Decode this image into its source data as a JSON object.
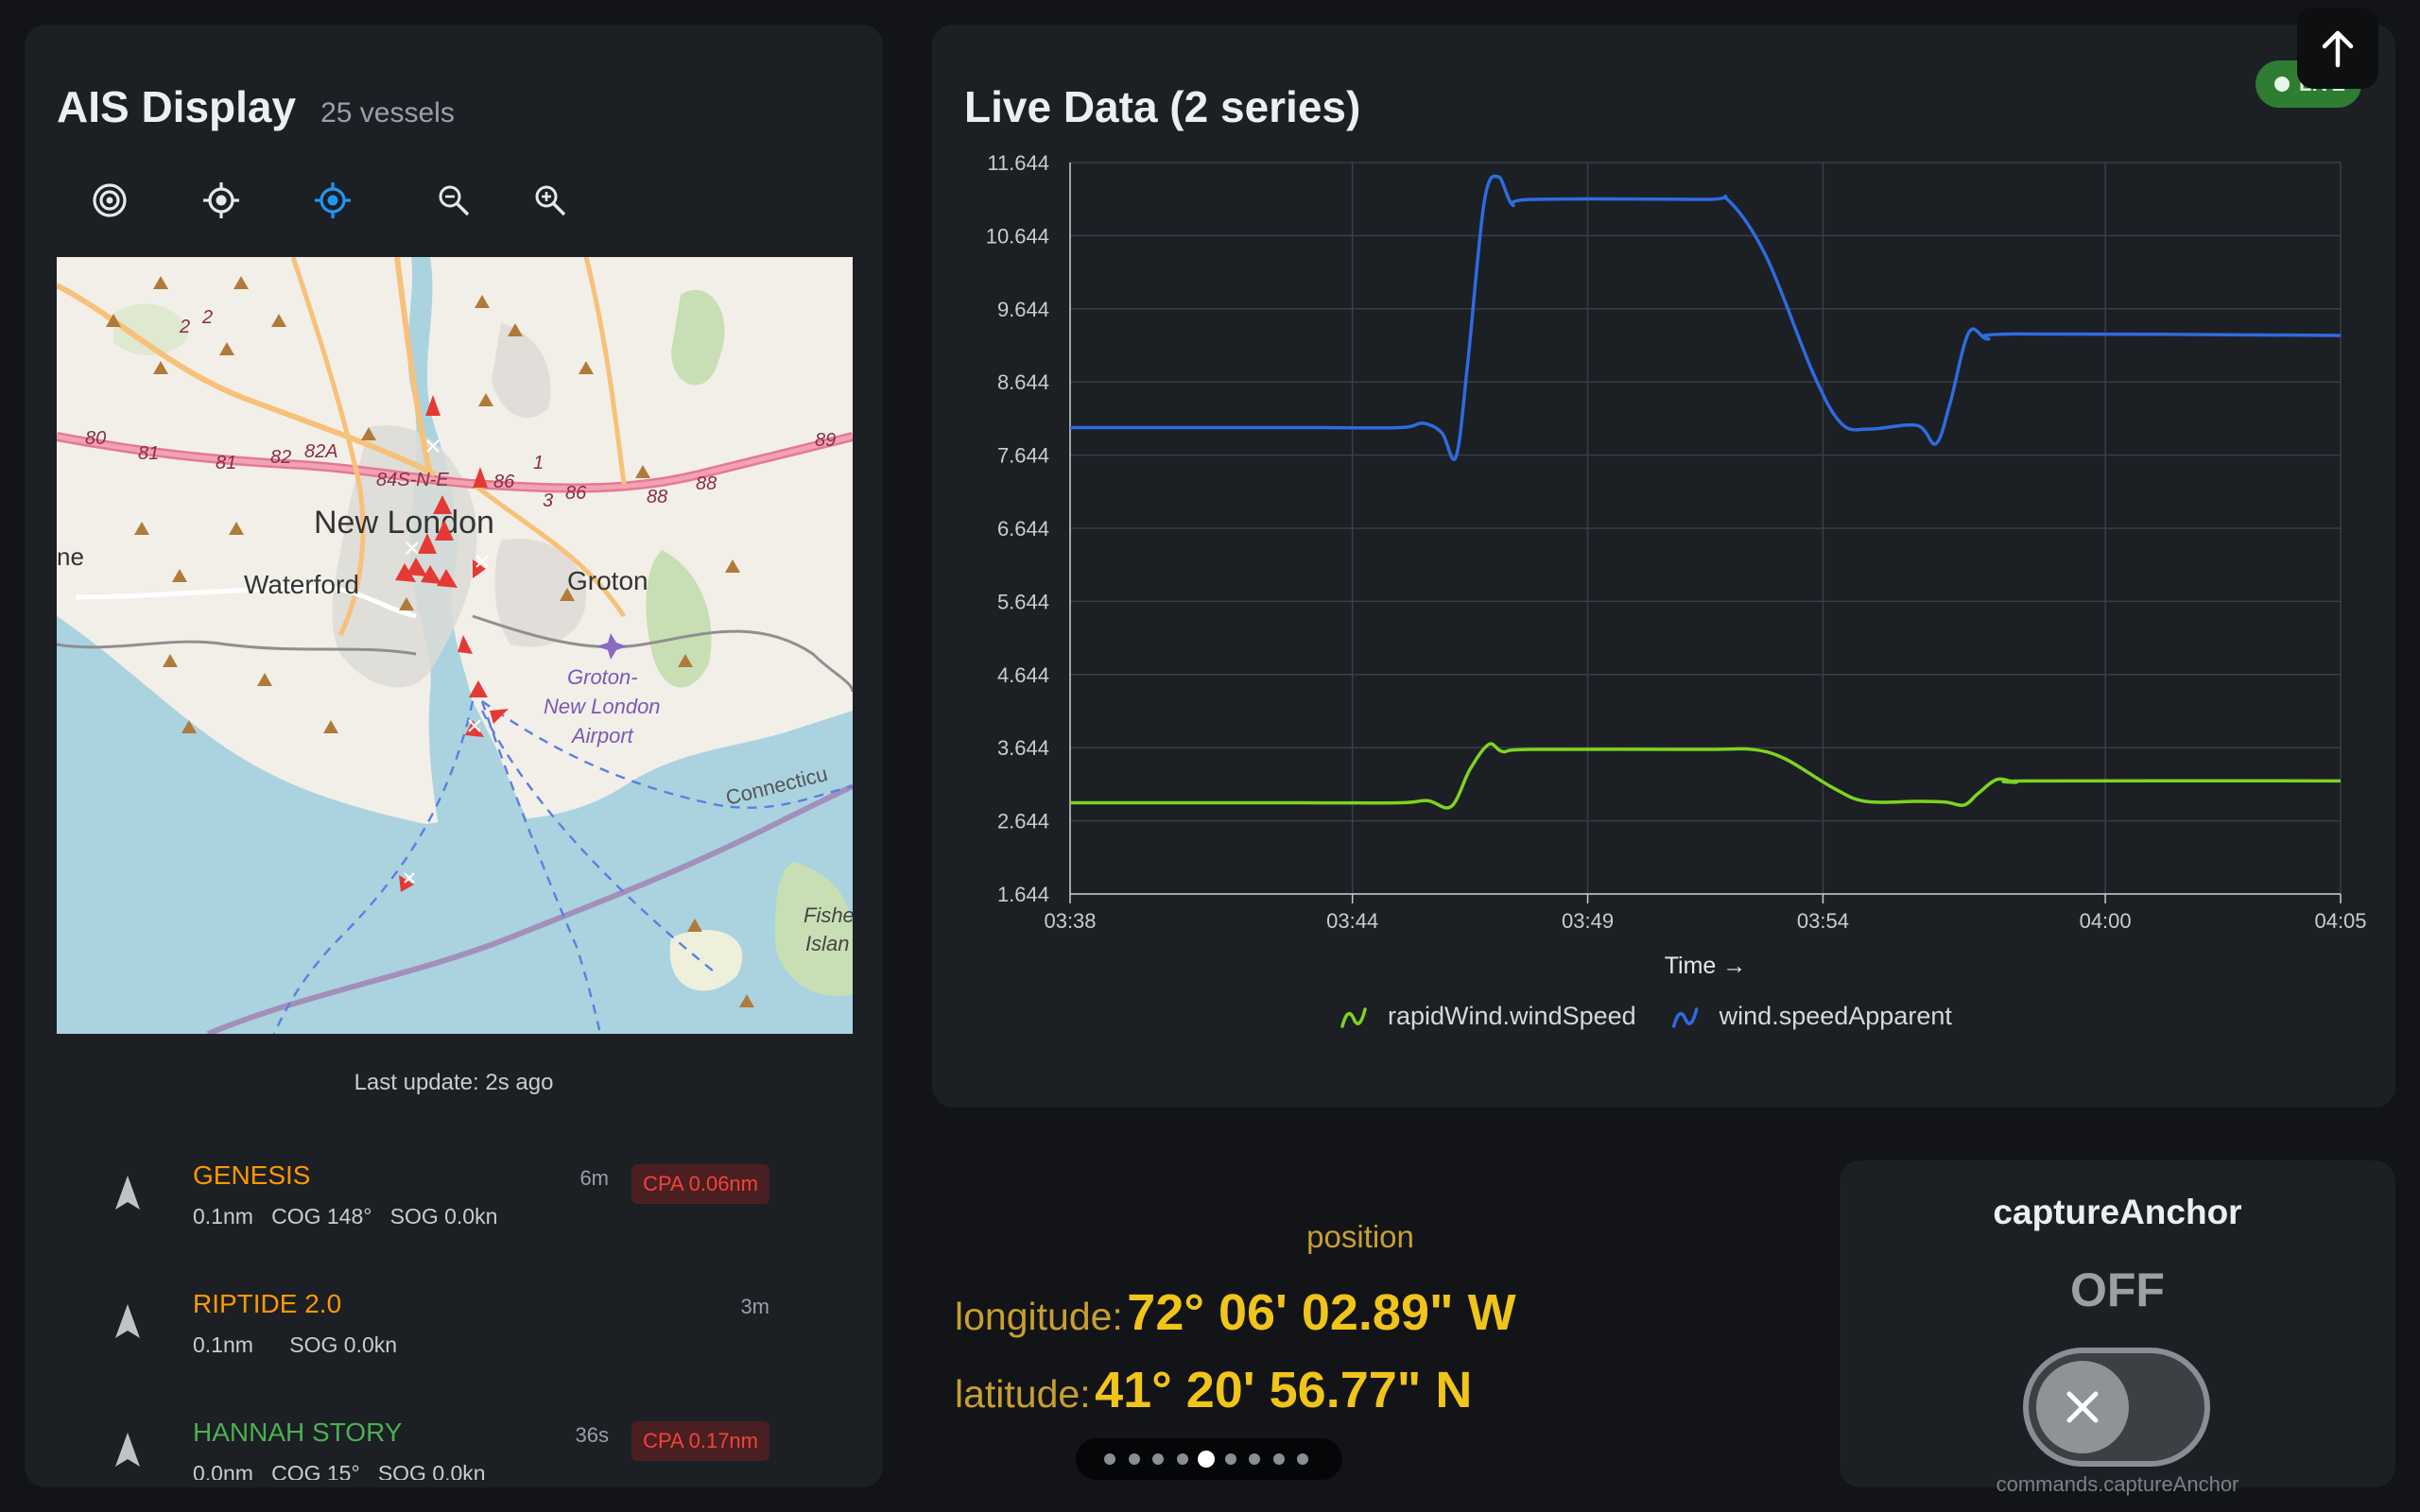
{
  "ais": {
    "title": "AIS Display",
    "vessel_count": "25 vessels",
    "toolbar": [
      "radar-icon",
      "center-icon",
      "follow-icon",
      "zoom-out-icon",
      "zoom-in-icon"
    ],
    "map": {
      "labels": [
        "New London",
        "Waterford",
        "Groton",
        "Groton-",
        "New London",
        "Airport",
        "Connecticu",
        "Fishe",
        "Islan",
        "ne",
        "80",
        "81",
        "81",
        "82",
        "82A",
        "84S-N-E",
        "86",
        "86",
        "88",
        "88",
        "89",
        "1",
        "3",
        "2",
        "2"
      ]
    },
    "last_update": "Last update: 2s ago",
    "vessels": [
      {
        "name": "GENESIS",
        "age": "6m",
        "detail": "0.1nm   COG 148°   SOG 0.0kn",
        "cpa": "CPA 0.06nm",
        "color": "#ff9800"
      },
      {
        "name": "RIPTIDE 2.0",
        "age": "3m",
        "detail": "0.1nm      SOG 0.0kn",
        "cpa": "",
        "color": "#ff9800"
      },
      {
        "name": "HANNAH STORY",
        "age": "36s",
        "detail": "0.0nm   COG 15°   SOG 0.0kn",
        "cpa": "CPA 0.17nm",
        "color": "#4caf50"
      }
    ]
  },
  "live": {
    "title": "Live Data (2 series)",
    "badge": "LIVE"
  },
  "chart_data": {
    "type": "line",
    "title": "",
    "xlabel": "Time →",
    "ylabel": "",
    "ylim": [
      1.644,
      11.644
    ],
    "xlim": [
      "03:38",
      "04:05"
    ],
    "x_ticks": [
      "03:38",
      "03:44",
      "03:49",
      "03:54",
      "04:00",
      "04:05"
    ],
    "y_ticks": [
      "1.644",
      "2.644",
      "3.644",
      "4.644",
      "5.644",
      "6.644",
      "7.644",
      "8.644",
      "9.644",
      "10.644",
      "11.644"
    ],
    "grid": true,
    "legend": "bottom",
    "series": [
      {
        "name": "rapidWind.windSpeed",
        "color": "#7ed321",
        "points": [
          [
            0,
            2.89
          ],
          [
            5,
            2.89
          ],
          [
            7,
            2.89
          ],
          [
            7.6,
            2.92
          ],
          [
            8.1,
            2.84
          ],
          [
            8.5,
            3.35
          ],
          [
            8.9,
            3.69
          ],
          [
            9.2,
            3.59
          ],
          [
            9.8,
            3.62
          ],
          [
            13.5,
            3.62
          ],
          [
            14.5,
            3.62
          ],
          [
            15.2,
            3.49
          ],
          [
            16.2,
            3.1
          ],
          [
            16.9,
            2.91
          ],
          [
            18.0,
            2.91
          ],
          [
            18.6,
            2.9
          ],
          [
            19.0,
            2.86
          ],
          [
            19.3,
            3.02
          ],
          [
            19.7,
            3.21
          ],
          [
            20.1,
            3.17
          ],
          [
            20.4,
            3.19
          ],
          [
            27,
            3.19
          ]
        ]
      },
      {
        "name": "wind.speedApparent",
        "color": "#2f6be0",
        "points": [
          [
            0,
            8.02
          ],
          [
            5,
            8.02
          ],
          [
            7,
            8.02
          ],
          [
            7.5,
            8.08
          ],
          [
            7.9,
            7.95
          ],
          [
            8.2,
            7.62
          ],
          [
            8.45,
            8.9
          ],
          [
            8.8,
            11.1
          ],
          [
            9.1,
            11.45
          ],
          [
            9.4,
            11.07
          ],
          [
            9.8,
            11.14
          ],
          [
            13.5,
            11.14
          ],
          [
            14.0,
            11.12
          ],
          [
            14.8,
            10.35
          ],
          [
            15.8,
            8.75
          ],
          [
            16.4,
            8.07
          ],
          [
            17.0,
            8.0
          ],
          [
            18.0,
            8.05
          ],
          [
            18.4,
            7.8
          ],
          [
            18.7,
            8.35
          ],
          [
            19.1,
            9.32
          ],
          [
            19.5,
            9.23
          ],
          [
            20.1,
            9.3
          ],
          [
            27,
            9.28
          ]
        ]
      }
    ]
  },
  "position": {
    "title": "position",
    "longitude_label": "longitude:",
    "longitude_value": "72° 06' 02.89\" W",
    "latitude_label": "latitude:",
    "latitude_value": "41° 20' 56.77\" N"
  },
  "pager": {
    "count": 9,
    "active": 4
  },
  "anchor": {
    "title": "captureAnchor",
    "state": "OFF",
    "path": "commands.captureAnchor"
  }
}
